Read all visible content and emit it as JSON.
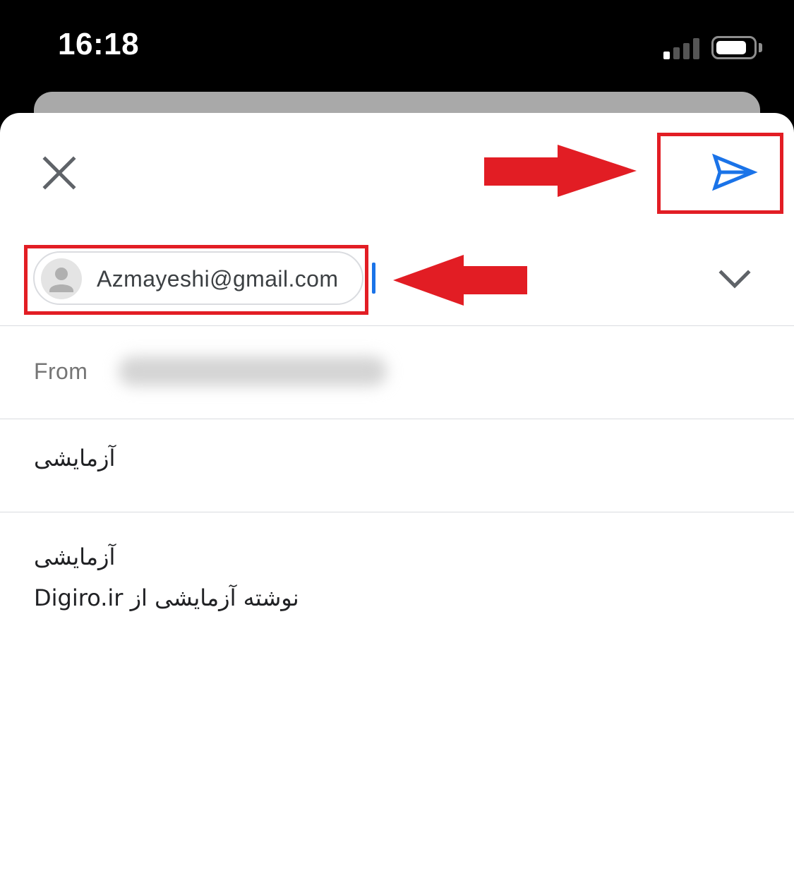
{
  "status_bar": {
    "time": "16:18",
    "signal_bars_filled": 1,
    "signal_bars_total": 4,
    "battery_level": 0.8
  },
  "header": {
    "close_icon": "close-icon",
    "send_icon": "send-icon",
    "accent_color": "#1a73e8"
  },
  "to": {
    "recipient": "Azmayeshi@gmail.com",
    "avatar_icon": "person-icon",
    "expand_icon": "chevron-down-icon"
  },
  "from": {
    "label": "From"
  },
  "subject": {
    "value": "آزمایشی"
  },
  "body": {
    "lines": [
      "آزمایشی",
      "نوشته آزمایشی از Digiro.ir"
    ]
  },
  "annotations": {
    "color": "#e21d24",
    "arrow_icon": "red-arrow",
    "highlight": "red-box"
  }
}
